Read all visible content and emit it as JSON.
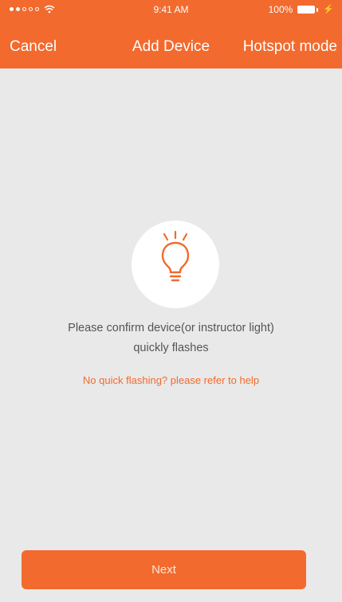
{
  "status_bar": {
    "time": "9:41 AM",
    "battery": "100%",
    "icons": [
      "signal-dots-icon",
      "wifi-icon",
      "battery-icon",
      "charging-bolt-icon"
    ]
  },
  "nav": {
    "cancel_label": "Cancel",
    "title": "Add Device",
    "hotspot_label": "Hotspot mode"
  },
  "main": {
    "icon": "light-bulb-icon",
    "message_line1": "Please confirm device(or instructor light)",
    "message_line2": "quickly flashes",
    "help_link": "No quick flashing?  please refer to help"
  },
  "footer": {
    "next_label": "Next"
  },
  "colors": {
    "accent": "#f26a2e",
    "background": "#e9e9e9",
    "text": "#555555"
  }
}
